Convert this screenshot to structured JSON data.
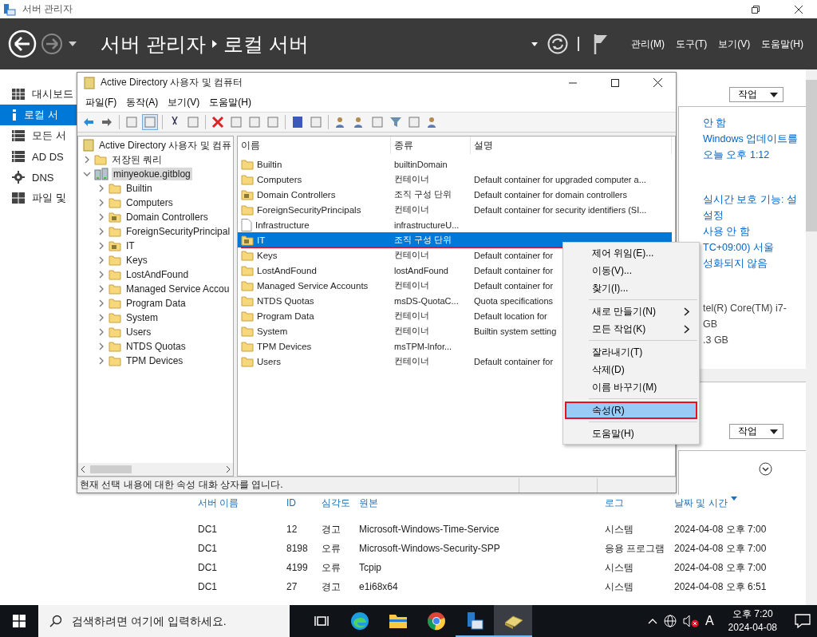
{
  "window": {
    "title": "서버 관리자"
  },
  "header": {
    "breadcrumb": [
      "서버 관리자",
      "로컬 서버"
    ],
    "menus": [
      "관리(M)",
      "도구(T)",
      "보기(V)",
      "도움말(H)"
    ]
  },
  "sidebar": {
    "items": [
      {
        "label": "대시보드",
        "kind": "dashboard",
        "selected": false
      },
      {
        "label": "로컬 서",
        "kind": "info",
        "selected": true
      },
      {
        "label": "모든 서",
        "kind": "servers",
        "selected": false
      },
      {
        "label": "AD DS",
        "kind": "servers",
        "selected": false
      },
      {
        "label": "DNS",
        "kind": "dns",
        "selected": false
      },
      {
        "label": "파일 및",
        "kind": "files",
        "selected": false
      }
    ]
  },
  "properties_panel": {
    "tasks_button": "작업",
    "groups": [
      [
        {
          "text": "안 함",
          "kind": "link"
        },
        {
          "text": "Windows 업데이트를",
          "kind": "link"
        },
        {
          "text": "오늘 오후 1:12",
          "kind": "link"
        }
      ],
      [
        {
          "text": "실시간 보호 기능: 설",
          "kind": "link"
        },
        {
          "text": "설정",
          "kind": "link"
        },
        {
          "text": "사용 안 함",
          "kind": "link"
        },
        {
          "text": "TC+09:00) 서울",
          "kind": "link"
        },
        {
          "text": "성화되지 않음",
          "kind": "link"
        }
      ],
      [
        {
          "text": "tel(R) Core(TM) i7-",
          "kind": "text"
        },
        {
          "text": "GB",
          "kind": "text"
        },
        {
          "text": ".3 GB",
          "kind": "text"
        }
      ]
    ]
  },
  "events_panel": {
    "tasks_button": "작업",
    "columns": [
      "서버 이름",
      "ID",
      "심각도",
      "원본",
      "로그",
      "날짜 및 시간"
    ],
    "rows": [
      [
        "DC1",
        "12",
        "경고",
        "Microsoft-Windows-Time-Service",
        "시스템",
        "2024-04-08 오후 7:00"
      ],
      [
        "DC1",
        "8198",
        "오류",
        "Microsoft-Windows-Security-SPP",
        "응용 프로그램",
        "2024-04-08 오후 7:00"
      ],
      [
        "DC1",
        "4199",
        "오류",
        "Tcpip",
        "시스템",
        "2024-04-08 오후 7:00"
      ],
      [
        "DC1",
        "27",
        "경고",
        "e1i68x64",
        "시스템",
        "2024-04-08 오후 6:51"
      ]
    ]
  },
  "ad_window": {
    "title": "Active Directory 사용자 및 컴퓨터",
    "menus": [
      "파일(F)",
      "동작(A)",
      "보기(V)",
      "도움말(H)"
    ],
    "tree": {
      "label": "Active Directory 사용자 및 컴퓨",
      "children": [
        {
          "label": "저장된 쿼리",
          "kind": "folder",
          "expanded": false,
          "selected": false
        },
        {
          "label": "minyeokue.gitblog",
          "kind": "domain",
          "expanded": true,
          "selected": true,
          "children": [
            {
              "label": "Builtin",
              "kind": "folder",
              "expanded": false,
              "selected": false
            },
            {
              "label": "Computers",
              "kind": "folder",
              "expanded": false,
              "selected": false
            },
            {
              "label": "Domain Controllers",
              "kind": "ou",
              "expanded": false,
              "selected": false
            },
            {
              "label": "ForeignSecurityPrincipal",
              "kind": "folder",
              "expanded": false,
              "selected": false
            },
            {
              "label": "IT",
              "kind": "ou",
              "expanded": false,
              "selected": false
            },
            {
              "label": "Keys",
              "kind": "folder",
              "expanded": false,
              "selected": false
            },
            {
              "label": "LostAndFound",
              "kind": "folder",
              "expanded": false,
              "selected": false
            },
            {
              "label": "Managed Service Accou",
              "kind": "folder",
              "expanded": false,
              "selected": false
            },
            {
              "label": "Program Data",
              "kind": "folder",
              "expanded": false,
              "selected": false
            },
            {
              "label": "System",
              "kind": "folder",
              "expanded": false,
              "selected": false
            },
            {
              "label": "Users",
              "kind": "folder",
              "expanded": false,
              "selected": false
            },
            {
              "label": "NTDS Quotas",
              "kind": "folder",
              "expanded": false,
              "selected": false
            },
            {
              "label": "TPM Devices",
              "kind": "folder",
              "expanded": false,
              "selected": false
            }
          ]
        }
      ]
    },
    "list": {
      "columns": [
        "이름",
        "종류",
        "설명"
      ],
      "rows": [
        {
          "name": "Builtin",
          "type": "builtinDomain",
          "kind": "folder",
          "selected": false
        },
        {
          "name": "Computers",
          "type": "컨테이너",
          "description": "Default container for upgraded computer a...",
          "kind": "folder",
          "selected": false
        },
        {
          "name": "Domain Controllers",
          "type": "조직 구성 단위",
          "description": "Default container for domain controllers",
          "kind": "ou",
          "selected": false
        },
        {
          "name": "ForeignSecurityPrincipals",
          "type": "컨테이너",
          "description": "Default container for security identifiers (SI...",
          "kind": "folder",
          "selected": false
        },
        {
          "name": "Infrastructure",
          "type": "infrastructureU...",
          "kind": "file",
          "selected": false
        },
        {
          "name": "IT",
          "type": "조직 구성 단위",
          "kind": "ou",
          "selected": true
        },
        {
          "name": "Keys",
          "type": "컨테이너",
          "description": "Default container for",
          "kind": "folder",
          "selected": false
        },
        {
          "name": "LostAndFound",
          "type": "lostAndFound",
          "description": "Default container for",
          "kind": "folder",
          "selected": false
        },
        {
          "name": "Managed Service Accounts",
          "type": "컨테이너",
          "description": "Default container for",
          "kind": "folder",
          "selected": false
        },
        {
          "name": "NTDS Quotas",
          "type": "msDS-QuotaC...",
          "description": "Quota specifications",
          "kind": "folder",
          "selected": false
        },
        {
          "name": "Program Data",
          "type": "컨테이너",
          "description": "Default location for",
          "kind": "folder",
          "selected": false
        },
        {
          "name": "System",
          "type": "컨테이너",
          "description": "Builtin system setting",
          "kind": "folder",
          "selected": false
        },
        {
          "name": "TPM Devices",
          "type": "msTPM-Infor...",
          "kind": "folder",
          "selected": false
        },
        {
          "name": "Users",
          "type": "컨테이너",
          "description": "Default container for",
          "kind": "folder",
          "selected": false
        }
      ]
    },
    "status_bar": "현재 선택 내용에 대한 속성 대화 상자를 엽니다."
  },
  "context_menu": {
    "groups": [
      [
        {
          "label": "제어 위임(E)...",
          "submenu": false,
          "selected": false
        },
        {
          "label": "이동(V)...",
          "submenu": false,
          "selected": false
        },
        {
          "label": "찾기(I)...",
          "submenu": false,
          "selected": false
        }
      ],
      [
        {
          "label": "새로 만들기(N)",
          "submenu": true,
          "selected": false
        },
        {
          "label": "모든 작업(K)",
          "submenu": true,
          "selected": false
        }
      ],
      [
        {
          "label": "잘라내기(T)",
          "submenu": false,
          "selected": false
        },
        {
          "label": "삭제(D)",
          "submenu": false,
          "selected": false
        },
        {
          "label": "이름 바꾸기(M)",
          "submenu": false,
          "selected": false
        }
      ],
      [
        {
          "label": "속성(R)",
          "submenu": false,
          "selected": true
        }
      ],
      [
        {
          "label": "도움말(H)",
          "submenu": false,
          "selected": false
        }
      ]
    ]
  },
  "taskbar": {
    "search": {
      "placeholder": "검색하려면 여기에 입력하세요."
    },
    "apps": [
      {
        "kind": "task-view",
        "running": false,
        "active": false
      },
      {
        "kind": "edge",
        "running": false,
        "active": false
      },
      {
        "kind": "explorer",
        "running": false,
        "active": false
      },
      {
        "kind": "chrome",
        "running": false,
        "active": false
      },
      {
        "kind": "server-manager",
        "running": true,
        "active": false
      },
      {
        "kind": "ad-users",
        "running": true,
        "active": true
      }
    ],
    "ime": "A",
    "time": "오후 7:20",
    "date": "2024-04-08"
  }
}
